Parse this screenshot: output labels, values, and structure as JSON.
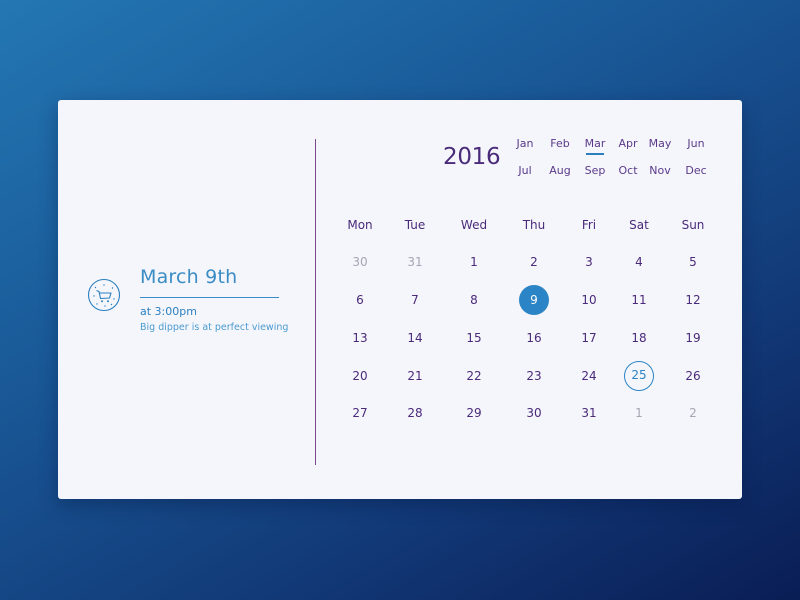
{
  "event": {
    "icon": "constellation-cart-icon",
    "date": "March 9th",
    "time": "at 3:00pm",
    "description": "Big dipper is at perfect viewing"
  },
  "calendar": {
    "year": "2016",
    "months": [
      "Jan",
      "Feb",
      "Mar",
      "Apr",
      "May",
      "Jun",
      "Jul",
      "Aug",
      "Sep",
      "Oct",
      "Nov",
      "Dec"
    ],
    "active_month": "Mar",
    "weekdays": [
      "Mon",
      "Tue",
      "Wed",
      "Thu",
      "Fri",
      "Sat",
      "Sun"
    ],
    "weeks": [
      [
        {
          "d": "30",
          "muted": true
        },
        {
          "d": "31",
          "muted": true
        },
        {
          "d": "1"
        },
        {
          "d": "2"
        },
        {
          "d": "3"
        },
        {
          "d": "4"
        },
        {
          "d": "5"
        }
      ],
      [
        {
          "d": "6"
        },
        {
          "d": "7"
        },
        {
          "d": "8"
        },
        {
          "d": "9",
          "selected": true
        },
        {
          "d": "10"
        },
        {
          "d": "11"
        },
        {
          "d": "12"
        }
      ],
      [
        {
          "d": "13"
        },
        {
          "d": "14"
        },
        {
          "d": "15"
        },
        {
          "d": "16"
        },
        {
          "d": "17"
        },
        {
          "d": "18"
        },
        {
          "d": "19"
        }
      ],
      [
        {
          "d": "20"
        },
        {
          "d": "21"
        },
        {
          "d": "22"
        },
        {
          "d": "23"
        },
        {
          "d": "24"
        },
        {
          "d": "25",
          "ring": true
        },
        {
          "d": "26"
        }
      ],
      [
        {
          "d": "27"
        },
        {
          "d": "28"
        },
        {
          "d": "29"
        },
        {
          "d": "30"
        },
        {
          "d": "31"
        },
        {
          "d": "1",
          "muted": true
        },
        {
          "d": "2",
          "muted": true
        }
      ]
    ]
  },
  "colors": {
    "accent": "#2b84c5",
    "text_primary": "#4a2a7a",
    "muted": "#a6a6b4",
    "card": "#f5f6fb"
  }
}
